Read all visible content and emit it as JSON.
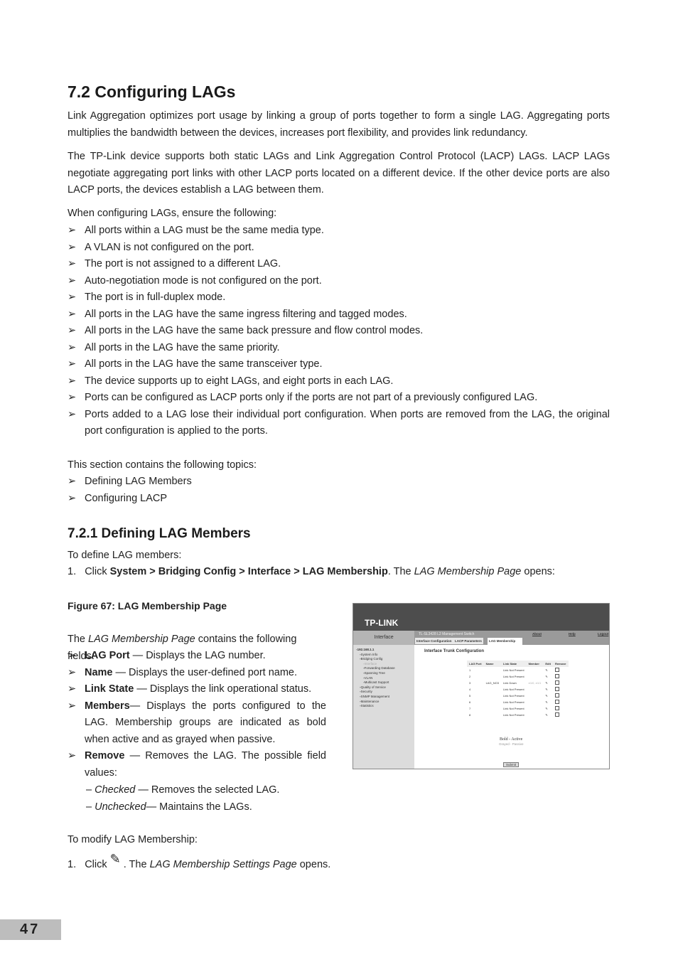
{
  "section": {
    "title": "7.2   Configuring LAGs",
    "p1": "Link Aggregation optimizes port usage by linking a group of ports together to form a single LAG. Aggregating ports multiplies the bandwidth between the devices, increases port flexibility, and provides link redundancy.",
    "p2": "The TP-Link device supports both static LAGs and Link Aggregation Control Protocol (LACP) LAGs. LACP LAGs negotiate aggregating port links with other LACP ports located on a different device. If the other device ports are also LACP ports, the devices establish a LAG between them.",
    "p3": "When configuring LAGs, ensure the following:",
    "bullets": [
      "All ports within a LAG must be the same media type.",
      "A VLAN is not configured on the port.",
      "The port is not assigned to a different LAG.",
      "Auto-negotiation mode is not configured on the port.",
      "The port is in full-duplex mode.",
      "All ports in the LAG have the same ingress filtering and tagged modes.",
      "All ports in the LAG have the same back pressure and flow control modes.",
      "All ports in the LAG have the same priority.",
      "All ports in the LAG have the same transceiver type.",
      "The device supports up to eight LAGs, and eight ports in each LAG.",
      "Ports can be configured as LACP ports only if the ports are not part of a previously configured LAG.",
      "Ports added to a LAG lose their individual port configuration. When ports are removed from the LAG, the original port configuration is applied to the ports."
    ],
    "topics_intro": "This section contains the following topics:",
    "topics": [
      "Defining LAG Members",
      "Configuring LACP"
    ]
  },
  "subsection": {
    "title": "7.2.1   Defining LAG Members",
    "intro": "To define LAG members:",
    "step1": {
      "num": "1.",
      "pre": "Click ",
      "bold": "System > Bridging Config > Interface > LAG Membership",
      "mid": ". The ",
      "italic": "LAG Membership Page",
      "post": " opens:"
    },
    "figure": "Figure 67: LAG Membership Page",
    "fields_intro": {
      "pre": "The ",
      "italic": "LAG Membership Page",
      "post": " contains the following fields:"
    },
    "fields": [
      {
        "name": "LAG Port",
        "desc": " — Displays the LAG number."
      },
      {
        "name": "Name",
        "desc": " — Displays the user-defined port name."
      },
      {
        "name": "Link State",
        "desc": " — Displays the link operational status."
      },
      {
        "name": "Members",
        "desc": "— Displays the ports configured to the LAG. Membership groups are indicated as bold when active and as grayed when passive."
      },
      {
        "name": "Remove",
        "desc": " — Removes the LAG. The possible field values:"
      }
    ],
    "values": [
      {
        "name": "Checked",
        "desc": " — Removes the selected LAG."
      },
      {
        "name": "Unchecked",
        "desc": "— Maintains the LAGs."
      }
    ],
    "modify": "To modify LAG Membership:",
    "step2": {
      "num": "1.",
      "pre": "Click",
      "post": ". The ",
      "italic": "LAG Membership Settings Page",
      "end": " opens."
    }
  },
  "screenshot": {
    "logo": "TP-LINK",
    "left_title": "Interface",
    "product": "TL-SL3428 L2 Management Switch",
    "links": [
      "About",
      "Help",
      "Logout"
    ],
    "tabs": [
      "Interface Configuration",
      "LACP Parameters",
      "LAG Membership"
    ],
    "tree": [
      "192.168.1.1",
      "System Info",
      "Bridging Config",
      "Interface",
      "Forwarding Database",
      "Spanning Tree",
      "VLAN",
      "Multicast Support",
      "Quality of Service",
      "Security",
      "SNMP Management",
      "Maintenance",
      "Statistics"
    ],
    "heading": "Interface Trunk Configuration",
    "columns": [
      "LAG Port",
      "Name",
      "Link State",
      "Member",
      "Edit",
      "Remove"
    ],
    "rows": [
      [
        "1",
        "",
        "Link Not Present",
        ""
      ],
      [
        "2",
        "",
        "Link Not Present",
        ""
      ],
      [
        "3",
        "LAG_NO3",
        "Link Down",
        "e1/0, e1/1"
      ],
      [
        "4",
        "",
        "Link Not Present",
        ""
      ],
      [
        "5",
        "",
        "Link Not Present",
        ""
      ],
      [
        "6",
        "",
        "Link Not Present",
        ""
      ],
      [
        "7",
        "",
        "Link Not Present",
        ""
      ],
      [
        "8",
        "",
        "Link Not Present",
        ""
      ]
    ],
    "legend_bold": "Bold - Active",
    "legend_gray": "Grayed - Passive",
    "submit": "Submit"
  },
  "page_number": "47"
}
